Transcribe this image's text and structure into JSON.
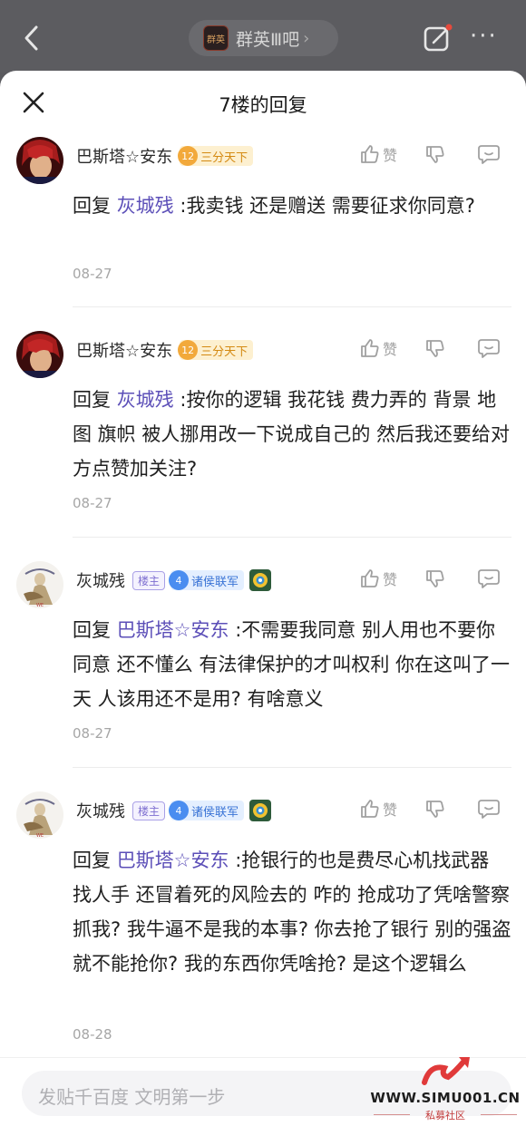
{
  "topbar": {
    "forum_name": "群英Ⅲ吧",
    "forum_logo_text": "群英",
    "chevron": "›",
    "more": "···"
  },
  "sheet": {
    "title": "7楼的回复"
  },
  "replies": [
    {
      "username": "巴斯塔☆安东",
      "level": "12",
      "level_title": "三分天下",
      "like_label": "赞",
      "prefix": "回复",
      "mention": "灰城残",
      "text": ":我卖钱 还是赠送 需要征求你同意?",
      "date": "08-27"
    },
    {
      "username": "巴斯塔☆安东",
      "level": "12",
      "level_title": "三分天下",
      "like_label": "赞",
      "prefix": "回复",
      "mention": "灰城残",
      "text": ":按你的逻辑 我花钱 费力弄的 背景 地图 旗帜 被人挪用改一下说成自己的 然后我还要给对方点赞加关注?",
      "date": "08-27"
    },
    {
      "username": "灰城残",
      "owner_badge": "楼主",
      "level": "4",
      "level_title": "诸侯联军",
      "like_label": "赞",
      "prefix": "回复",
      "mention": "巴斯塔☆安东",
      "text": ":不需要我同意 别人用也不要你同意 还不懂么 有法律保护的才叫权利 你在这叫了一天 人该用还不是用? 有啥意义",
      "date": "08-27"
    },
    {
      "username": "灰城残",
      "owner_badge": "楼主",
      "level": "4",
      "level_title": "诸侯联军",
      "like_label": "赞",
      "prefix": "回复",
      "mention": "巴斯塔☆安东",
      "text": ":抢银行的也是费尽心机找武器 找人手 还冒着死的风险去的 咋的 抢成功了凭啥警察抓我? 我牛逼不是我的本事? 你去抢了银行 别的强盗就不能抢你? 我的东西你凭啥抢? 是这个逻辑么",
      "date": "08-28"
    }
  ],
  "bottom": {
    "placeholder": "发贴千百度 文明第一步"
  },
  "watermark": {
    "site": "WWW.SIMU001.CN",
    "sub": "私募社区"
  },
  "colors": {
    "mention": "#5c4fb8",
    "level_gold": "#f2a93b",
    "level_blue": "#4a8df0",
    "owner_purple": "#7e6fd0"
  }
}
